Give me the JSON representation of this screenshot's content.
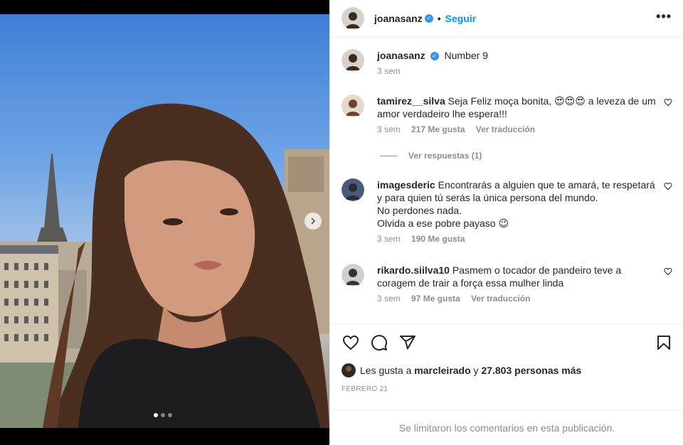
{
  "post": {
    "author": "joanasanz",
    "follow_label": "Seguir",
    "more_label": "•••",
    "caption": "Number 9",
    "caption_time": "3 sem",
    "carousel": {
      "total": 3,
      "active": 0
    }
  },
  "comments": [
    {
      "user": "tamirez__silva",
      "text": "Seja Feliz moça bonita, 😍😍😍 a leveza de um amor verdadeiro lhe espera!!!",
      "time": "3 sem",
      "likes": "217 Me gusta",
      "translate": "Ver traducción"
    },
    {
      "user": "imagesderic",
      "text": "Encontrarás a alguien que te amará, te respetará y para quien tú serás la única persona del mundo.",
      "text2": "No perdones nada.",
      "text3": "Olvida a ese pobre payaso 😉",
      "time": "3 sem",
      "likes": "190 Me gusta"
    },
    {
      "user": "rikardo.siilva10",
      "text": "Pasmem o tocador de pandeiro teve a coragem de trair a força essa mulher linda",
      "time": "3 sem",
      "likes": "97 Me gusta",
      "translate": "Ver traducción"
    }
  ],
  "replies_label": "Ver respuestas (1)",
  "likes_bar": {
    "prefix": "Les gusta a",
    "user": "marcleirado",
    "mid": "y",
    "count": "27.803 personas más"
  },
  "date": "FEBRERO 21",
  "footer": "Se limitaron los comentarios en esta publicación.",
  "colors": {
    "link": "#0095f6",
    "verified": "#3897f0",
    "muted": "#8e8e8e"
  }
}
